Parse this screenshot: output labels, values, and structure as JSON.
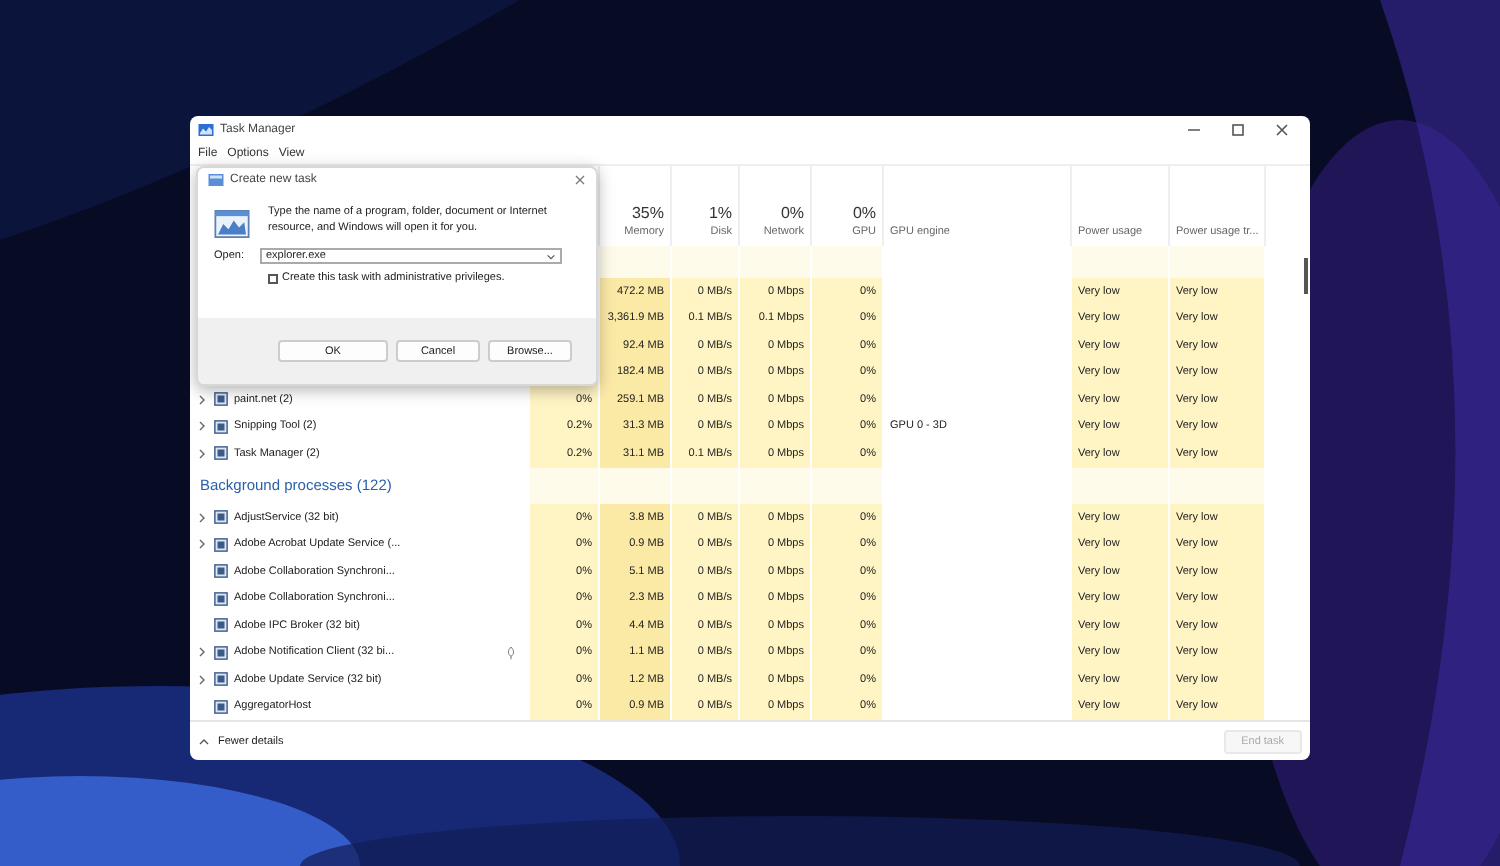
{
  "window": {
    "title": "Task Manager"
  },
  "menu": [
    "File",
    "Options",
    "View"
  ],
  "columns": [
    {
      "percent": "35%",
      "label": "Memory"
    },
    {
      "percent": "1%",
      "label": "Disk"
    },
    {
      "percent": "0%",
      "label": "Network"
    },
    {
      "percent": "0%",
      "label": "GPU"
    },
    {
      "label": "GPU engine"
    },
    {
      "label": "Power usage"
    },
    {
      "label": "Power usage tr..."
    }
  ],
  "rows": [
    {
      "kind": "spacer"
    },
    {
      "kind": "process",
      "memory": "472.2 MB",
      "disk": "0 MB/s",
      "network": "0 Mbps",
      "gpu": "0%",
      "power": "Very low",
      "power_trend": "Very low"
    },
    {
      "kind": "process",
      "memory": "3,361.9 MB",
      "disk": "0.1 MB/s",
      "network": "0.1 Mbps",
      "gpu": "0%",
      "power": "Very low",
      "power_trend": "Very low"
    },
    {
      "kind": "process",
      "memory": "92.4 MB",
      "disk": "0 MB/s",
      "network": "0 Mbps",
      "gpu": "0%",
      "power": "Very low",
      "power_trend": "Very low"
    },
    {
      "kind": "process",
      "memory": "182.4 MB",
      "disk": "0 MB/s",
      "network": "0 Mbps",
      "gpu": "0%",
      "power": "Very low",
      "power_trend": "Very low"
    },
    {
      "kind": "process",
      "expandable": true,
      "name": "paint.net (2)",
      "cpu": "0%",
      "memory": "259.1 MB",
      "disk": "0 MB/s",
      "network": "0 Mbps",
      "gpu": "0%",
      "power": "Very low",
      "power_trend": "Very low"
    },
    {
      "kind": "process",
      "expandable": true,
      "name": "Snipping Tool (2)",
      "cpu": "0.2%",
      "memory": "31.3 MB",
      "disk": "0 MB/s",
      "network": "0 Mbps",
      "gpu": "0%",
      "gpu_engine": "GPU 0 - 3D",
      "power": "Very low",
      "power_trend": "Very low"
    },
    {
      "kind": "process",
      "expandable": true,
      "name": "Task Manager (2)",
      "cpu": "0.2%",
      "memory": "31.1 MB",
      "disk": "0.1 MB/s",
      "network": "0 Mbps",
      "gpu": "0%",
      "power": "Very low",
      "power_trend": "Very low"
    },
    {
      "kind": "heading",
      "name": "Background processes (122)"
    },
    {
      "kind": "process",
      "expandable": true,
      "name": "AdjustService (32 bit)",
      "cpu": "0%",
      "memory": "3.8 MB",
      "disk": "0 MB/s",
      "network": "0 Mbps",
      "gpu": "0%",
      "power": "Very low",
      "power_trend": "Very low"
    },
    {
      "kind": "process",
      "expandable": true,
      "name": "Adobe Acrobat Update Service (...",
      "cpu": "0%",
      "memory": "0.9 MB",
      "disk": "0 MB/s",
      "network": "0 Mbps",
      "gpu": "0%",
      "power": "Very low",
      "power_trend": "Very low"
    },
    {
      "kind": "process",
      "expandable": false,
      "name": "Adobe Collaboration Synchroni...",
      "cpu": "0%",
      "memory": "5.1 MB",
      "disk": "0 MB/s",
      "network": "0 Mbps",
      "gpu": "0%",
      "power": "Very low",
      "power_trend": "Very low"
    },
    {
      "kind": "process",
      "expandable": false,
      "name": "Adobe Collaboration Synchroni...",
      "cpu": "0%",
      "memory": "2.3 MB",
      "disk": "0 MB/s",
      "network": "0 Mbps",
      "gpu": "0%",
      "power": "Very low",
      "power_trend": "Very low"
    },
    {
      "kind": "process",
      "expandable": false,
      "name": "Adobe IPC Broker (32 bit)",
      "cpu": "0%",
      "memory": "4.4 MB",
      "disk": "0 MB/s",
      "network": "0 Mbps",
      "gpu": "0%",
      "power": "Very low",
      "power_trend": "Very low"
    },
    {
      "kind": "process",
      "expandable": true,
      "name": "Adobe Notification Client (32 bi...",
      "suspended": true,
      "cpu": "0%",
      "memory": "1.1 MB",
      "disk": "0 MB/s",
      "network": "0 Mbps",
      "gpu": "0%",
      "power": "Very low",
      "power_trend": "Very low"
    },
    {
      "kind": "process",
      "expandable": true,
      "name": "Adobe Update Service (32 bit)",
      "cpu": "0%",
      "memory": "1.2 MB",
      "disk": "0 MB/s",
      "network": "0 Mbps",
      "gpu": "0%",
      "power": "Very low",
      "power_trend": "Very low"
    },
    {
      "kind": "process",
      "expandable": false,
      "name": "AggregatorHost",
      "cpu": "0%",
      "memory": "0.9 MB",
      "disk": "0 MB/s",
      "network": "0 Mbps",
      "gpu": "0%",
      "power": "Very low",
      "power_trend": "Very low"
    }
  ],
  "footer": {
    "details_label": "Fewer details",
    "end_task": {
      "label": "End task",
      "disabled": true
    }
  },
  "dialog": {
    "title": "Create new task",
    "message": "Type the name of a program, folder, document or Internet resource, and Windows will open it for you.",
    "open_label": "Open:",
    "open_value": "explorer.exe",
    "admin": {
      "label": "Create this task with administrative privileges.",
      "checked": false
    },
    "buttons": [
      "OK",
      "Cancel",
      "Browse..."
    ]
  }
}
